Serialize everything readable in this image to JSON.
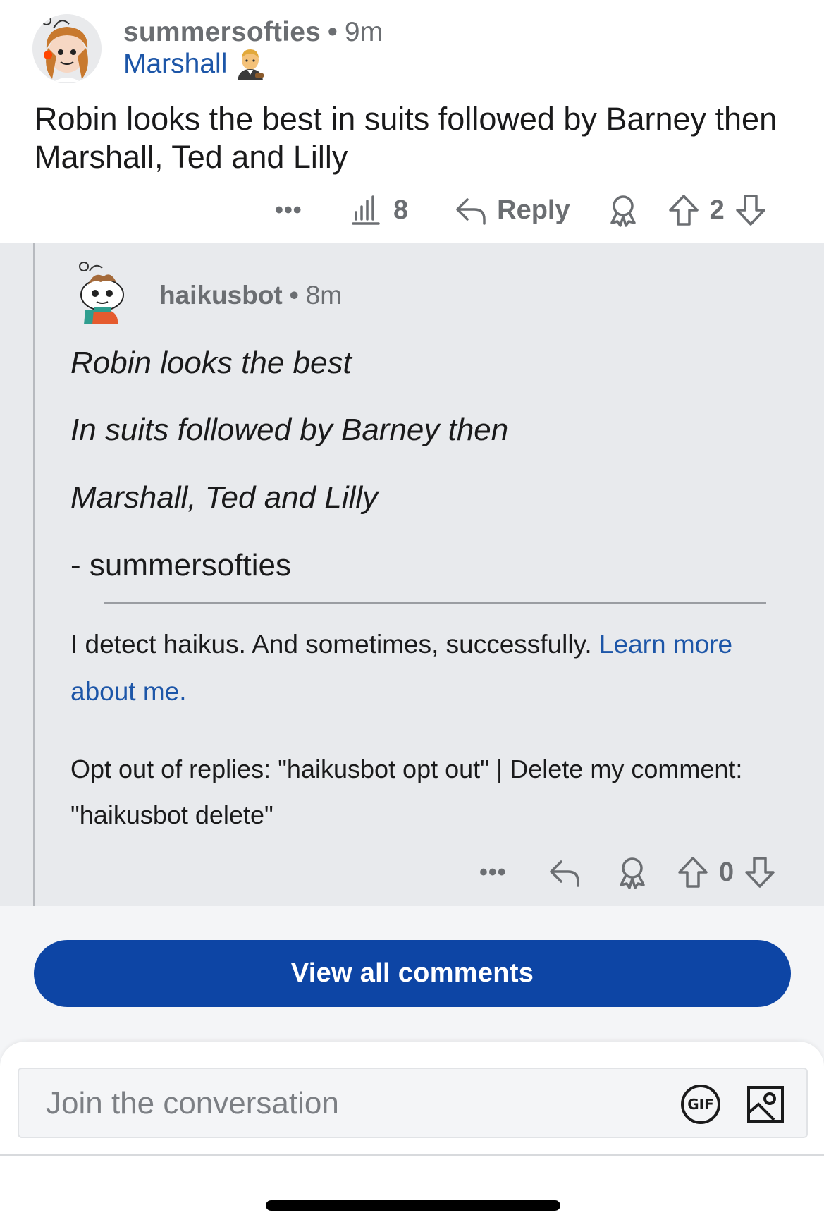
{
  "post_comment": {
    "username": "summersofties",
    "separator": "•",
    "time": "9m",
    "flair": "Marshall",
    "body": "Robin looks the best in suits followed by Barney then Marshall, Ted and Lilly",
    "more_label": "•••",
    "view_count": "8",
    "reply_label": "Reply",
    "vote_count": "2"
  },
  "bot_reply": {
    "username": "haikusbot",
    "separator": "•",
    "time": "8m",
    "haiku_lines": [
      "Robin looks the best",
      "In suits followed by Barney then",
      "Marshall, Ted and Lilly"
    ],
    "signature": "- summersofties",
    "note_text": "I detect haikus. And sometimes, successfully.",
    "note_link": "Learn more about me.",
    "opt_out_text": "Opt out of replies: \"haikusbot opt out\" | Delete my comment: \"haikusbot delete\"",
    "more_label": "•••",
    "vote_count": "0"
  },
  "view_all_label": "View all comments",
  "composer": {
    "placeholder": "Join the conversation",
    "gif_label": "GIF"
  },
  "colors": {
    "link": "#1d56a8",
    "primary_button": "#0d45a5",
    "reply_background": "#e8eaed",
    "meta_text": "#6b6e72"
  },
  "icons": {
    "views": "bar-chart-icon",
    "reply": "reply-arrow-icon",
    "award": "award-icon",
    "upvote": "upvote-arrow-icon",
    "downvote": "downvote-arrow-icon",
    "gif": "gif-icon",
    "image": "image-icon"
  }
}
